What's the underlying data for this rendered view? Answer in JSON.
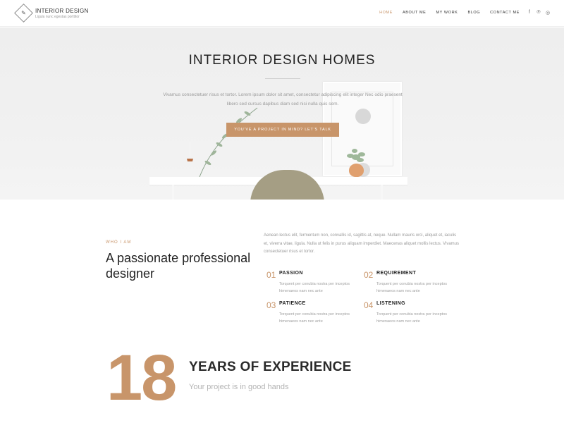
{
  "header": {
    "logo_title": "INTERIOR DESIGN",
    "logo_subtitle": "Ligula nunc egestas porttitor",
    "nav": [
      {
        "label": "HOME",
        "active": true
      },
      {
        "label": "ABOUT ME",
        "active": false
      },
      {
        "label": "MY WORK",
        "active": false
      },
      {
        "label": "BLOG",
        "active": false
      },
      {
        "label": "CONTACT ME",
        "active": false
      }
    ],
    "social_icons": [
      "facebook-icon",
      "pinterest-icon",
      "instagram-icon"
    ]
  },
  "hero": {
    "title": "INTERIOR DESIGN HOMES",
    "text": "Vivamus consectetuer risus et tortor. Lorem ipsum dolor sit amet, consectetur adipiscing elit integer Nec odio praesent libero sed cursus dapibus diam sed nisi nulla quis sem.",
    "button_label": "YOU'VE A PROJECT IN MIND? LET'S TALK"
  },
  "about": {
    "label": "WHO I AM",
    "title": "A passionate professional designer",
    "text": "Aenean lectus elit, fermentum non, convallis id, sagittis at, neque. Nullam mauris orci, aliquet et, iaculis et, viverra vitae, ligula. Nulla ut felis in purus aliquam imperdiet. Maecenas aliquet mollis lectus. Vivamus consectetuer risus et tortor.",
    "features": [
      {
        "num": "01",
        "title": "PASSION",
        "desc": "Torquent per conubia nostra per inceptos himenaeos nam nec ante"
      },
      {
        "num": "02",
        "title": "REQUIREMENT",
        "desc": "Torquent per conubia nostra per inceptos himenaeos nam nec ante"
      },
      {
        "num": "03",
        "title": "PATIENCE",
        "desc": "Torquent per conubia nostra per inceptos himenaeos nam nec ante"
      },
      {
        "num": "04",
        "title": "LISTENING",
        "desc": "Torquent per conubia nostra per inceptos himenaeos nam nec ante"
      }
    ]
  },
  "experience": {
    "number": "18",
    "title": "YEARS OF EXPERIENCE",
    "subtitle": "Your project is in good hands"
  },
  "colors": {
    "accent": "#c8956a",
    "text": "#222222",
    "muted": "#9a9a9a"
  }
}
